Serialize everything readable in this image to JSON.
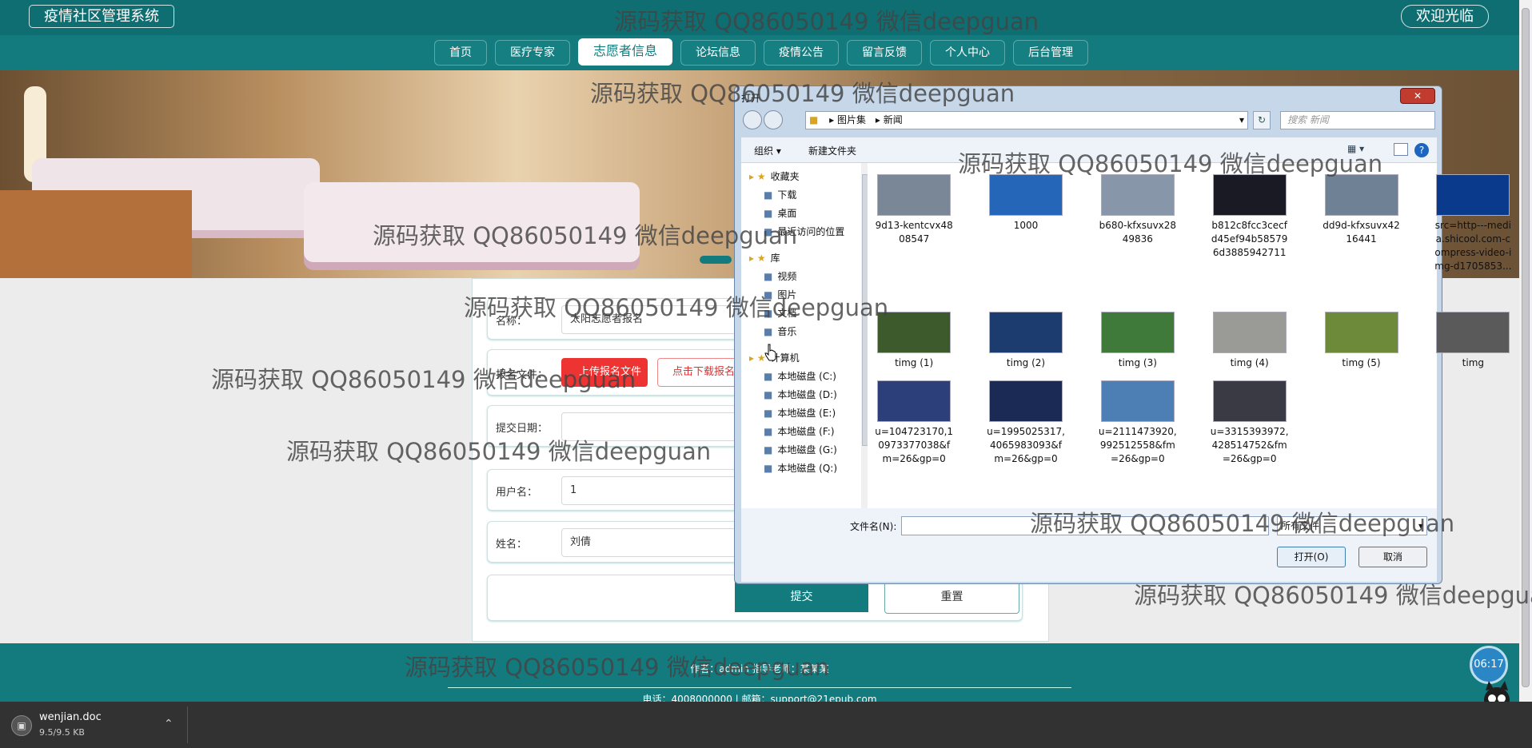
{
  "header": {
    "brand": "疫情社区管理系统",
    "welcome": "欢迎光临"
  },
  "nav": [
    {
      "label": "首页",
      "active": false
    },
    {
      "label": "医疗专家",
      "active": false
    },
    {
      "label": "志愿者信息",
      "active": true
    },
    {
      "label": "论坛信息",
      "active": false
    },
    {
      "label": "疫情公告",
      "active": false
    },
    {
      "label": "留言反馈",
      "active": false
    },
    {
      "label": "个人中心",
      "active": false
    },
    {
      "label": "后台管理",
      "active": false
    }
  ],
  "form": {
    "name_label": "名称：",
    "name_value": "太阳志愿者报名",
    "file_label": "报名文件：",
    "upload_label": "上传报名文件",
    "download_label": "点击下载报名",
    "date_label": "提交日期：",
    "username_label": "用户名：",
    "username_value": "1",
    "realname_label": "姓名：",
    "realname_value": "刘倩",
    "submit": "提交",
    "reset": "重置"
  },
  "footer": {
    "line1": "作者：admin 指导老师：某某某",
    "line2": "电话：4008000000 | 邮箱：support@21epub.com"
  },
  "clock": "06:17",
  "download": {
    "file": "wenjian.doc",
    "size": "9.5/9.5 KB"
  },
  "watermark_text": "源码获取 QQ86050149 微信deepguan",
  "dialog": {
    "title": "打开",
    "path": [
      "图片集",
      "新闻"
    ],
    "search_placeholder": "搜索 新闻",
    "organize": "组织 ▾",
    "new_folder": "新建文件夹",
    "sidebar": [
      {
        "label": "收藏夹",
        "level": 0
      },
      {
        "label": "下载",
        "level": 1
      },
      {
        "label": "桌面",
        "level": 1
      },
      {
        "label": "最近访问的位置",
        "level": 1
      },
      {
        "label": "库",
        "level": 0
      },
      {
        "label": "视频",
        "level": 1
      },
      {
        "label": "图片",
        "level": 1
      },
      {
        "label": "文档",
        "level": 1
      },
      {
        "label": "音乐",
        "level": 1
      },
      {
        "label": "计算机",
        "level": 0
      },
      {
        "label": "本地磁盘 (C:)",
        "level": 1
      },
      {
        "label": "本地磁盘 (D:)",
        "level": 1
      },
      {
        "label": "本地磁盘 (E:)",
        "level": 1
      },
      {
        "label": "本地磁盘 (F:)",
        "level": 1
      },
      {
        "label": "本地磁盘 (G:)",
        "level": 1
      },
      {
        "label": "本地磁盘 (Q:)",
        "level": 1
      }
    ],
    "files": [
      {
        "name": "9d13-kentcvx4808547",
        "color": "#7a8796"
      },
      {
        "name": "1000",
        "color": "#2566b8"
      },
      {
        "name": "b680-kfxsuvx2849836",
        "color": "#8796a8"
      },
      {
        "name": "b812c8fcc3cecfd45ef94b585796d3885942711",
        "color": "#1a1a24"
      },
      {
        "name": "dd9d-kfxsuvx4216441",
        "color": "#6f8295"
      },
      {
        "name": "src=http---media.shicool.com-compress-video-img-d1705853...",
        "color": "#0a3a8c"
      },
      {
        "name": "timg (1)",
        "color": "#3d5a2c"
      },
      {
        "name": "timg (2)",
        "color": "#1c3b6e"
      },
      {
        "name": "timg (3)",
        "color": "#3f7a3a"
      },
      {
        "name": "timg (4)",
        "color": "#9a9a96"
      },
      {
        "name": "timg (5)",
        "color": "#6d8a3a"
      },
      {
        "name": "timg",
        "color": "#5a5a5a"
      },
      {
        "name": "u=104723170,10973377038&fm=26&gp=0",
        "color": "#2c3f7a"
      },
      {
        "name": "u=1995025317,4065983093&fm=26&gp=0",
        "color": "#1b2a55"
      },
      {
        "name": "u=2111473920,992512558&fm=26&gp=0",
        "color": "#4d7fb5"
      },
      {
        "name": "u=3315393972,428514752&fm=26&gp=0",
        "color": "#3a3a44"
      }
    ],
    "filename_label": "文件名(N):",
    "filetype": "所有文件",
    "open": "打开(O)",
    "cancel": "取消"
  }
}
